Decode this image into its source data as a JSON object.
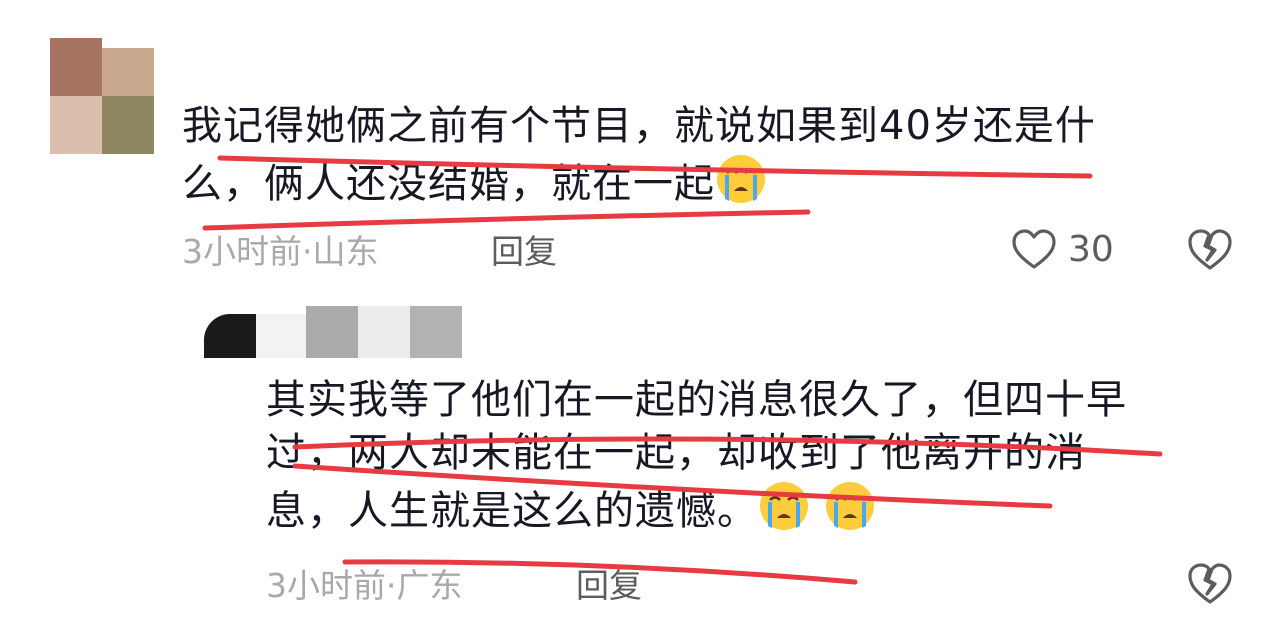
{
  "comments": [
    {
      "text_lines": [
        "我记得她俩之前有个节目，就说如果到40岁还是什",
        "么，俩人还没结婚，就在一起"
      ],
      "emoji_count": 1,
      "time_location": "3小时前·山东",
      "reply_label": "回复",
      "likes": "30"
    },
    {
      "text_lines": [
        "其实我等了他们在一起的消息很久了，但四十早",
        "过，两人却未能在一起，却收到了他离开的消",
        "息，人生就是这么的遗憾。"
      ],
      "emoji_count": 2,
      "time_location": "3小时前·广东",
      "reply_label": "回复"
    }
  ],
  "icons": {
    "like": "heart-outline-icon",
    "dislike": "broken-heart-icon",
    "emoji": "loudly-crying-face-emoji"
  },
  "colors": {
    "text": "#161823",
    "meta": "#a9a9ad",
    "annotation_line": "#e83a43"
  }
}
